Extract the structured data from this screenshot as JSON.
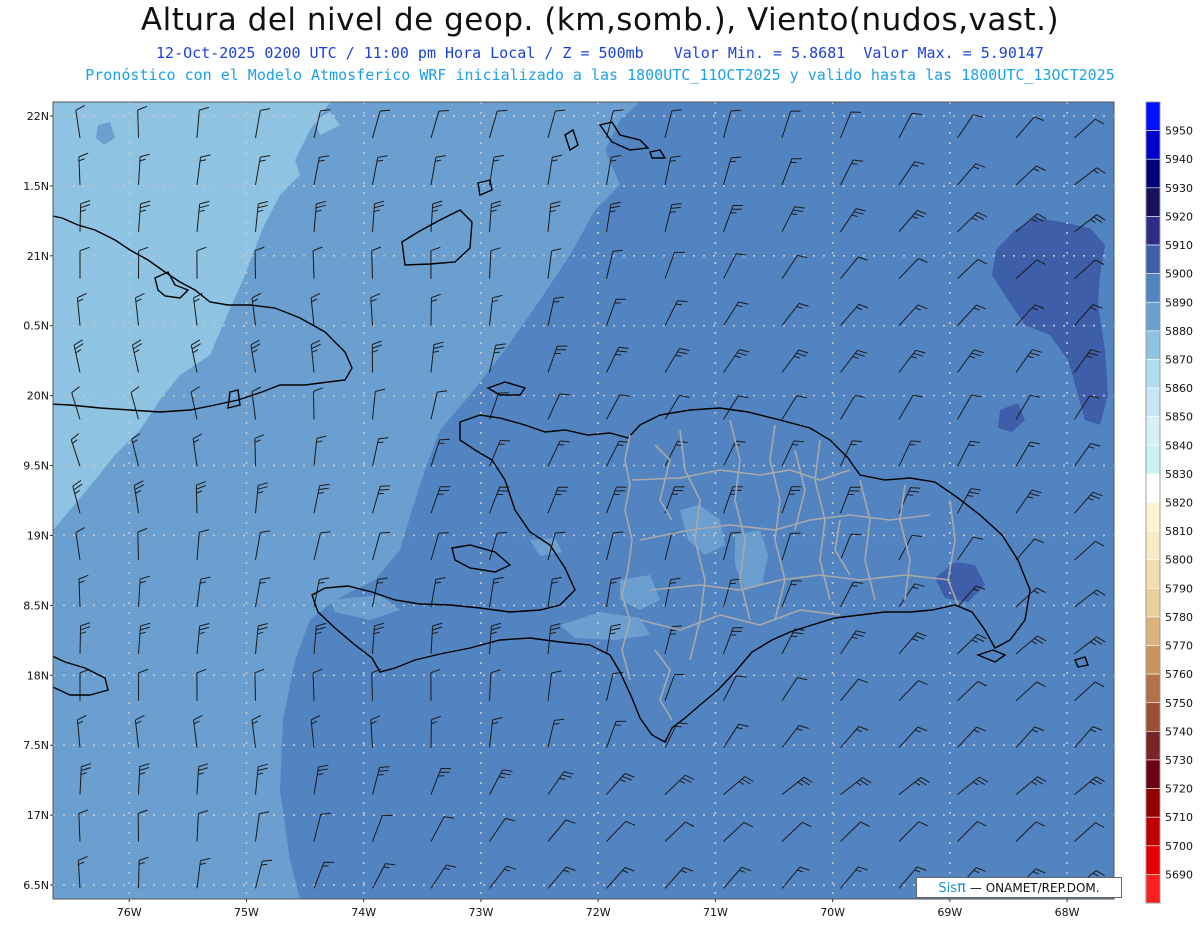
{
  "header": {
    "title": "Altura del nivel de geop. (km,somb.), Viento(nudos,vast.)",
    "subtitle_left": "12-Oct-2025  0200 UTC / 11:00 pm Hora Local / Z = 500mb",
    "subtitle_min": "Valor Min. = 5.8681",
    "subtitle_max": "Valor Max. = 5.90147",
    "model_line": "Pronóstico con el Modelo Atmosferico WRF inicializado a las 1800UTC_11OCT2025 y valido hasta las  1800UTC_13OCT2025"
  },
  "map": {
    "lat_labels": [
      {
        "lat": 22.0,
        "label": "22N"
      },
      {
        "lat": 21.5,
        "label": "1.5N"
      },
      {
        "lat": 21.0,
        "label": "21N"
      },
      {
        "lat": 20.5,
        "label": "0.5N"
      },
      {
        "lat": 20.0,
        "label": "20N"
      },
      {
        "lat": 19.5,
        "label": "9.5N"
      },
      {
        "lat": 19.0,
        "label": "19N"
      },
      {
        "lat": 18.5,
        "label": "8.5N"
      },
      {
        "lat": 18.0,
        "label": "18N"
      },
      {
        "lat": 17.5,
        "label": "7.5N"
      },
      {
        "lat": 17.0,
        "label": "17N"
      },
      {
        "lat": 16.5,
        "label": "6.5N"
      }
    ],
    "lon_labels": [
      {
        "lon": -76,
        "label": "76W"
      },
      {
        "lon": -75,
        "label": "75W"
      },
      {
        "lon": -74,
        "label": "74W"
      },
      {
        "lon": -73,
        "label": "73W"
      },
      {
        "lon": -72,
        "label": "72W"
      },
      {
        "lon": -71,
        "label": "71W"
      },
      {
        "lon": -70,
        "label": "70W"
      },
      {
        "lon": -69,
        "label": "69W"
      },
      {
        "lon": -68,
        "label": "68W"
      }
    ],
    "lon_range": [
      -76.65,
      -67.6
    ],
    "lat_range": [
      16.4,
      22.1
    ],
    "grid_lines": "dotted",
    "field_colors": {
      "5870": "#8fc3e2",
      "5880": "#6a9fd0",
      "5890": "#5384c2",
      "5900": "#3f5ea9"
    }
  },
  "colorbar": {
    "levels": [
      {
        "value": "5950",
        "color": "#0011ff"
      },
      {
        "value": "5940",
        "color": "#0000cc"
      },
      {
        "value": "5930",
        "color": "#00007a"
      },
      {
        "value": "5920",
        "color": "#18125e"
      },
      {
        "value": "5910",
        "color": "#2e2e88"
      },
      {
        "value": "5900",
        "color": "#3f5ea9"
      },
      {
        "value": "5890",
        "color": "#5384c2"
      },
      {
        "value": "5880",
        "color": "#6a9fd0"
      },
      {
        "value": "5870",
        "color": "#8fc3e2"
      },
      {
        "value": "5860",
        "color": "#b0dcef"
      },
      {
        "value": "5850",
        "color": "#c6e8f4"
      },
      {
        "value": "5840",
        "color": "#d7f0f8"
      },
      {
        "value": "5830",
        "color": "#c8f2f6"
      },
      {
        "value": "5820",
        "color": "#ffffff"
      },
      {
        "value": "5810",
        "color": "#fdf3cf"
      },
      {
        "value": "5800",
        "color": "#f9ebc4"
      },
      {
        "value": "5790",
        "color": "#f2dfb0"
      },
      {
        "value": "5780",
        "color": "#ebd09a"
      },
      {
        "value": "5770",
        "color": "#dcb37c"
      },
      {
        "value": "5760",
        "color": "#c99460"
      },
      {
        "value": "5750",
        "color": "#b27148"
      },
      {
        "value": "5740",
        "color": "#9a4e34"
      },
      {
        "value": "5730",
        "color": "#7c2328"
      },
      {
        "value": "5720",
        "color": "#6a0012"
      },
      {
        "value": "5710",
        "color": "#900000"
      },
      {
        "value": "5700",
        "color": "#c00000"
      },
      {
        "value": "5690",
        "color": "#e60000"
      },
      {
        "value": "",
        "color": "#ff1f1f"
      }
    ]
  },
  "credit": {
    "brand": "Sis",
    "pi": "π",
    "tail": "— ONAMET/REP.DOM."
  }
}
